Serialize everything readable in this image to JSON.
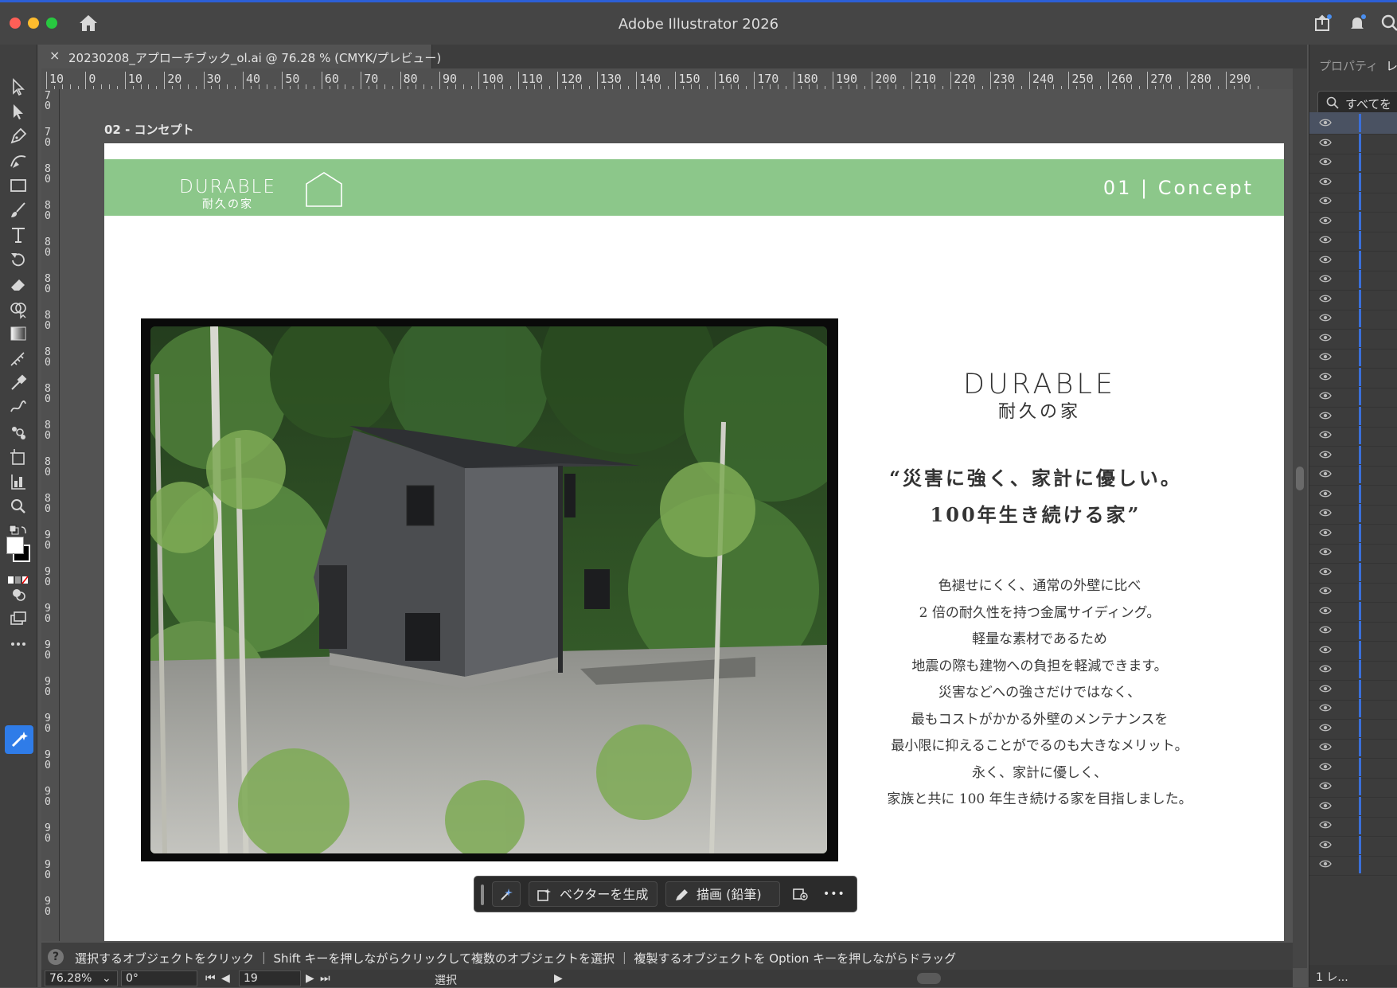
{
  "window": {
    "app_title": "Adobe Illustrator 2026"
  },
  "document_tab": {
    "close": "×",
    "name": "20230208_アプローチブック_ol.ai @ 76.28 % (CMYK/プレビュー)"
  },
  "ruler_top": [
    "10",
    "0",
    "10",
    "20",
    "30",
    "40",
    "50",
    "60",
    "70",
    "80",
    "90",
    "100",
    "110",
    "120",
    "130",
    "140",
    "150",
    "160",
    "170",
    "180",
    "190",
    "200",
    "210",
    "220",
    "230",
    "240",
    "250",
    "260",
    "270",
    "280",
    "290"
  ],
  "ruler_left": [
    "70",
    "70",
    "80",
    "80",
    "80",
    "80",
    "80",
    "80",
    "80",
    "80",
    "80",
    "80",
    "90",
    "90",
    "90",
    "90",
    "90",
    "90",
    "90",
    "90",
    "90",
    "90",
    "90"
  ],
  "artboard": {
    "label": "02 - コンセプト",
    "band": {
      "logo_en": "DURABLE",
      "logo_jp": "耐久の家",
      "section": "01 | Concept",
      "color": "#8cc78a"
    },
    "logo_en": "DURABLE",
    "logo_jp": "耐久の家",
    "headline": [
      "“災害に強く、家計に優しい。",
      "100年生き続ける家”"
    ],
    "body": [
      "色褪せにくく、通常の外壁に比べ",
      "2 倍の耐久性を持つ金属サイディング。",
      "軽量な素材であるため",
      "地震の際も建物への負担を軽減できます。",
      "災害などへの強さだけではなく、",
      "最もコストがかかる外壁のメンテナンスを",
      "最小限に抑えることがでるのも大きなメリット。",
      "永く、家計に優しく、",
      "家族と共に 100 年生き続ける家を目指しました。"
    ]
  },
  "context_bar": {
    "generate_vector": "ベクターを生成",
    "draw_pencil": "描画 (鉛筆)",
    "more": "•••"
  },
  "status": {
    "help": "?",
    "hint": "選択するオブジェクトをクリック ｜ Shift キーを押しながらクリックして複数のオブジェクトを選択 ｜ 複製するオブジェクトを Option キーを押しながらドラッグ",
    "zoom": "76.28%",
    "rotation": "0°",
    "artboard_number": "19",
    "tool": "選択"
  },
  "right_panel": {
    "tab_properties": "プロパティ",
    "tab_layers": "レ",
    "search_placeholder": "すべてを",
    "footer": "1 レ..."
  },
  "colors": {
    "accent": "#2f7ce8",
    "band_green": "#8cc78a"
  }
}
